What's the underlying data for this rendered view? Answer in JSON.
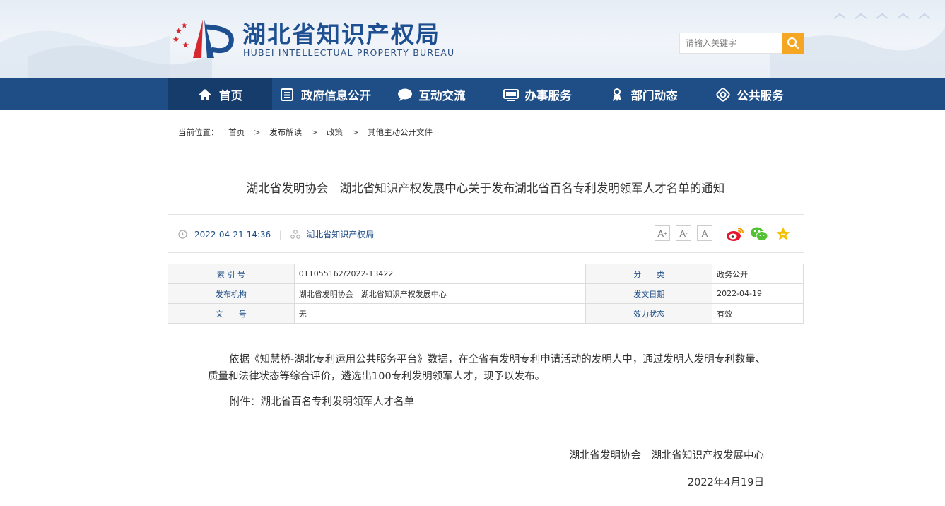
{
  "header": {
    "site_title": "湖北省知识产权局",
    "site_subtitle": "HUBEI INTELLECTUAL PROPERTY BUREAU",
    "search_placeholder": "请输入关键字",
    "colors": {
      "banner_bg": "#e9eff6",
      "title": "#1d4f91",
      "search_button": "#f5a623"
    }
  },
  "nav": {
    "color": "#1f4e87",
    "active_color": "#163c6b",
    "items": [
      {
        "label": "首页",
        "icon": "home-icon"
      },
      {
        "label": "政府信息公开",
        "icon": "document-list-icon"
      },
      {
        "label": "互动交流",
        "icon": "chat-bubble-icon"
      },
      {
        "label": "办事服务",
        "icon": "monitor-icon"
      },
      {
        "label": "部门动态",
        "icon": "person-badge-icon"
      },
      {
        "label": "公共服务",
        "icon": "compass-icon"
      }
    ]
  },
  "breadcrumb": {
    "prefix": "当前位置：",
    "items": [
      "首页",
      "发布解读",
      "政策",
      "其他主动公开文件"
    ],
    "separator": ">"
  },
  "article": {
    "title": "湖北省发明协会　湖北省知识产权发展中心关于发布湖北省百名专利发明领军人才名单的通知",
    "datetime": "2022-04-21 14:36",
    "source": "湖北省知识产权局",
    "font_buttons": [
      "A",
      "A",
      "A"
    ],
    "share_icons": [
      "weibo-icon",
      "wechat-icon",
      "favorite-star-icon"
    ],
    "info_table": [
      [
        {
          "k": "索 引 号",
          "v": "011055162/2022-13422"
        },
        {
          "k": "分　　类",
          "v": "政务公开"
        }
      ],
      [
        {
          "k": "发布机构",
          "v": "湖北省发明协会　湖北省知识产权发展中心"
        },
        {
          "k": "发文日期",
          "v": "2022-04-19"
        }
      ],
      [
        {
          "k": "文　　号",
          "v": "无"
        },
        {
          "k": "效力状态",
          "v": "有效"
        }
      ]
    ],
    "body": "依据《知慧桥-湖北专利运用公共服务平台》数据，在全省有发明专利申请活动的发明人中，通过发明人发明专利数量、质量和法律状态等综合评价，遴选出100专利发明领军人才，现予以发布。",
    "attachment": "附件：湖北省百名专利发明领军人才名单",
    "signature_org": "湖北省发明协会　湖北省知识产权发展中心",
    "signature_date": "2022年4月19日"
  }
}
